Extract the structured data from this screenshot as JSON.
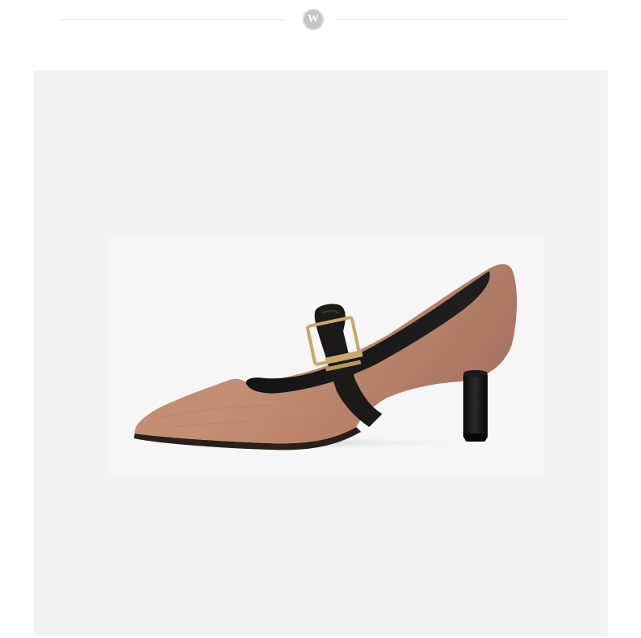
{
  "header": {
    "logo_letter": "W",
    "logo_icon": "w-monogram-icon"
  },
  "product": {
    "icon": "mary-jane-pump-shoe",
    "colors": {
      "panel_background": "#f3f3f3",
      "upper": "#bf8a71",
      "strap": "#1d1a18",
      "buckle": "#c7a76a",
      "heel": "#151515"
    }
  }
}
